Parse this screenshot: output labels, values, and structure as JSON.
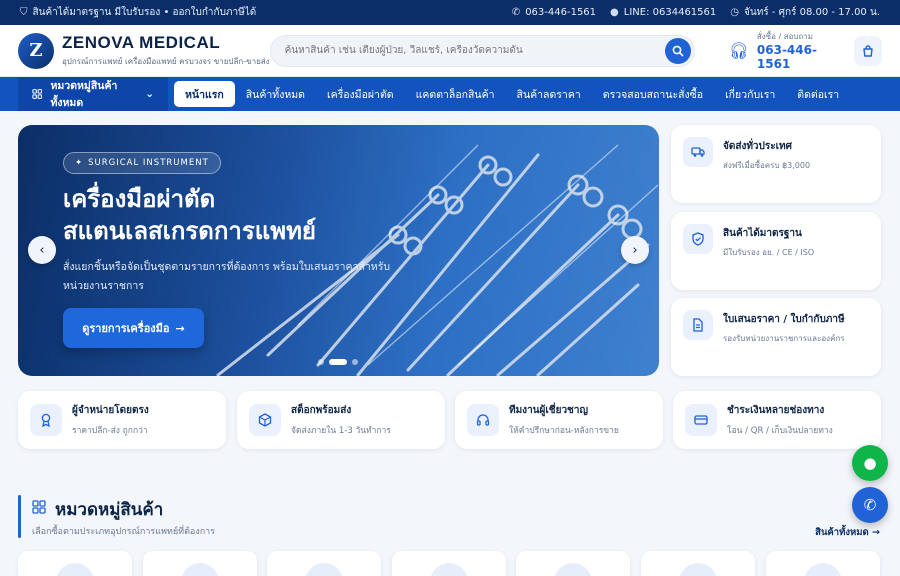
{
  "topbar": {
    "left_text": "สินค้าได้มาตรฐาน มีใบรับรอง • ออกใบกำกับภาษีได้",
    "phone": "063-446-1561",
    "line": "LINE: 0634461561",
    "hours": "จันทร์ - ศุกร์ 08.00 - 17.00 น."
  },
  "header": {
    "brand_name": "ZENOVA MEDICAL",
    "brand_tagline": "อุปกรณ์การแพทย์ เครื่องมือแพทย์ ครบวงจร ขายปลีก-ขายส่ง",
    "search_placeholder": "ค้นหาสินค้า เช่น เตียงผู้ป่วย, วีลแชร์, เครื่องวัดความดัน",
    "contact_label": "สั่งซื้อ / สอบถาม",
    "contact_phone": "063-446-1561"
  },
  "nav": {
    "category_button": "หมวดหมู่สินค้าทั้งหมด",
    "items": [
      {
        "label": "หน้าแรก"
      },
      {
        "label": "สินค้าทั้งหมด"
      },
      {
        "label": "เครื่องมือผ่าตัด"
      },
      {
        "label": "แคตตาล็อกสินค้า"
      },
      {
        "label": "สินค้าลดราคา"
      },
      {
        "label": "ตรวจสอบสถานะสั่งซื้อ"
      },
      {
        "label": "เกี่ยวกับเรา"
      },
      {
        "label": "ติดต่อเรา"
      }
    ],
    "active_index": 0
  },
  "hero": {
    "badge": "SURGICAL INSTRUMENT",
    "title_line1": "เครื่องมือผ่าตัด",
    "title_line2": "สแตนเลสเกรดการแพทย์",
    "subtitle": "สั่งแยกชิ้นหรือจัดเป็นชุดตามรายการที่ต้องการ พร้อมใบเสนอราคาสำหรับหน่วยงานราชการ",
    "cta": "ดูรายการเครื่องมือ",
    "slide_count": 3,
    "active_slide": 1
  },
  "side_cards": [
    {
      "icon": "truck-icon",
      "title": "จัดส่งทั่วประเทศ",
      "text": "ส่งฟรีเมื่อซื้อครบ ฿3,000"
    },
    {
      "icon": "shield-check-icon",
      "title": "สินค้าได้มาตรฐาน",
      "text": "มีใบรับรอง อย. / CE / ISO"
    },
    {
      "icon": "document-icon",
      "title": "ใบเสนอราคา / ใบกำกับภาษี",
      "text": "รองรับหน่วยงานราชการและองค์กร"
    }
  ],
  "features": [
    {
      "icon": "award-icon",
      "title": "ผู้จำหน่ายโดยตรง",
      "text": "ราคาปลีก-ส่ง ถูกกว่า"
    },
    {
      "icon": "box-icon",
      "title": "สต็อกพร้อมส่ง",
      "text": "จัดส่งภายใน 1-3 วันทำการ"
    },
    {
      "icon": "headset-icon",
      "title": "ทีมงานผู้เชี่ยวชาญ",
      "text": "ให้คำปรึกษาก่อน-หลังการขาย"
    },
    {
      "icon": "credit-card-icon",
      "title": "ชำระเงินหลายช่องทาง",
      "text": "โอน / QR / เก็บเงินปลายทาง"
    }
  ],
  "categories_section": {
    "title": "หมวดหมู่สินค้า",
    "subtitle": "เลือกซื้อตามประเภทอุปกรณ์การแพทย์ที่ต้องการ",
    "link": "สินค้าทั้งหมด"
  },
  "colors": {
    "topbar": "#0b2e68",
    "nav": "#1353c0",
    "accent": "#1f63d6",
    "line_green": "#10b54a"
  }
}
